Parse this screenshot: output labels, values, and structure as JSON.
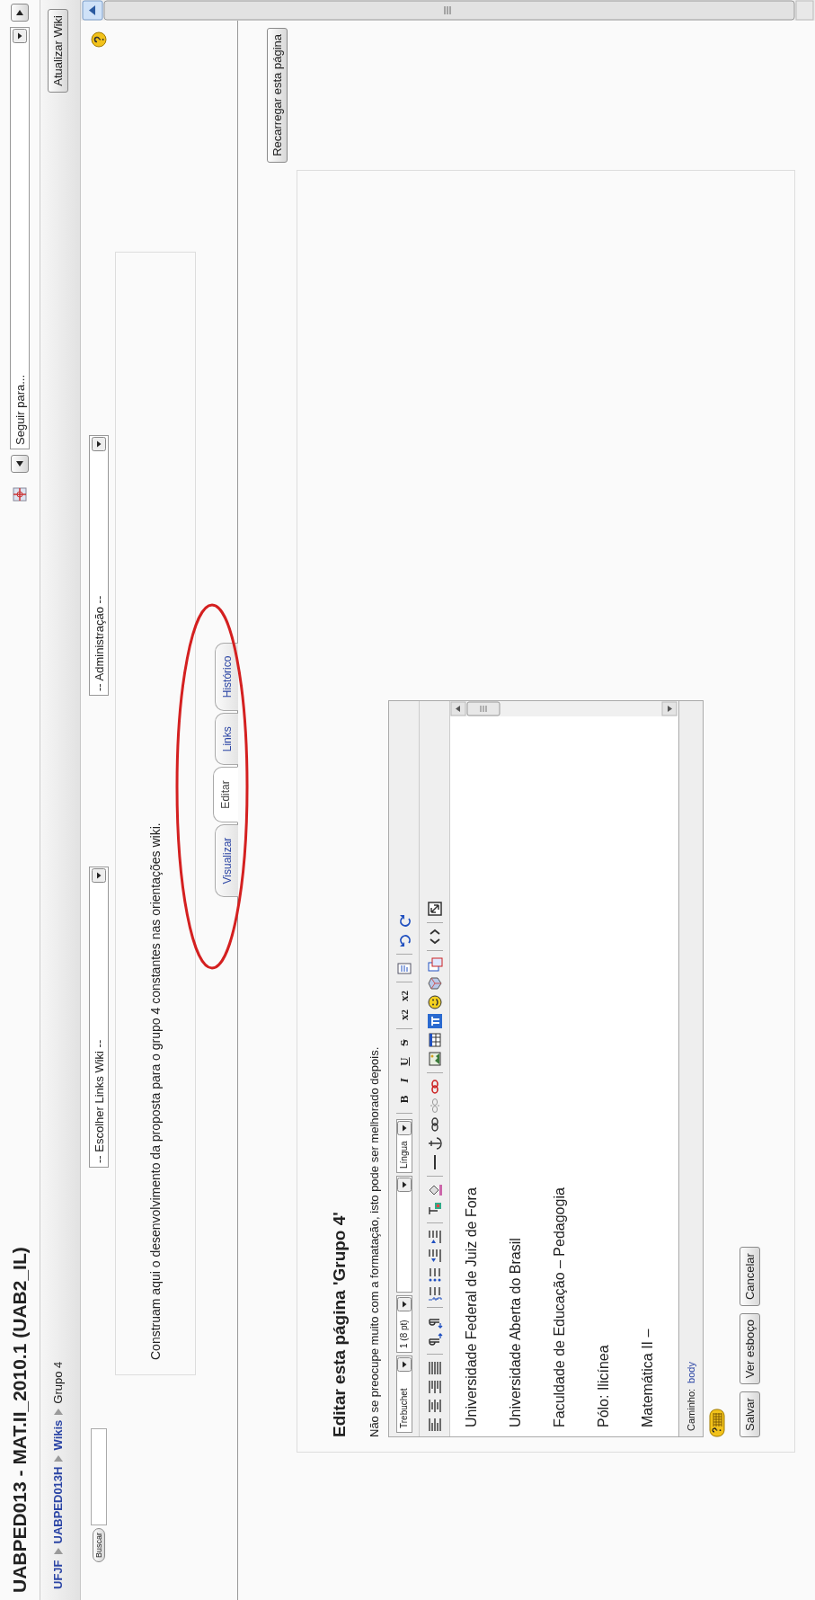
{
  "header": {
    "title": "UABPED013 - MAT.II_2010.1 (UAB2_IL)",
    "jump_select": "Seguir para..."
  },
  "navbar": {
    "breadcrumb": [
      {
        "label": "UFJF",
        "current": false
      },
      {
        "label": "UABPED013H",
        "current": false
      },
      {
        "label": "Wikis",
        "current": false
      },
      {
        "label": "Grupo 4",
        "current": true
      }
    ],
    "button": "Atualizar Wiki"
  },
  "wiki_tools": {
    "search_button": "Buscar",
    "links_select": "-- Escolher Links Wiki --",
    "admin_select": "-- Administração --"
  },
  "description": "Construam aqui o desenvolvimento da proposta para o grupo 4 constantes nas orientações wiki.",
  "tabs": [
    {
      "label": "Visualizar",
      "selected": false
    },
    {
      "label": "Editar",
      "selected": true
    },
    {
      "label": "Links",
      "selected": false
    },
    {
      "label": "Histórico",
      "selected": false
    }
  ],
  "reload_button": "Recarregar esta página",
  "editor": {
    "heading": "Editar esta página 'Grupo 4'",
    "note": "Não se preocupe muito com a formatação, isto pode ser melhorado depois.",
    "font_select": "Trebuchet",
    "size_select": "1 (8 pt)",
    "language_select": "Língua",
    "format_buttons": [
      {
        "kind": "bold",
        "label": "B"
      },
      {
        "kind": "italic",
        "label": "I"
      },
      {
        "kind": "underline",
        "label": "U"
      },
      {
        "kind": "strike",
        "label": "S"
      },
      {
        "kind": "subscript",
        "label": "x$_{2}$"
      },
      {
        "kind": "superscript",
        "label": "x$^{2}$"
      }
    ],
    "lines": [
      "Universidade Federal de Juiz de Fora",
      "Universidade Aberta do Brasil",
      "Faculdade de Educação – Pedagogia",
      "Pólo: Ilicínea",
      "Matemática II –"
    ],
    "path_label": "Caminho:",
    "path_value": "body"
  },
  "buttons": [
    "Salvar",
    "Ver esboço",
    "Cancelar"
  ]
}
